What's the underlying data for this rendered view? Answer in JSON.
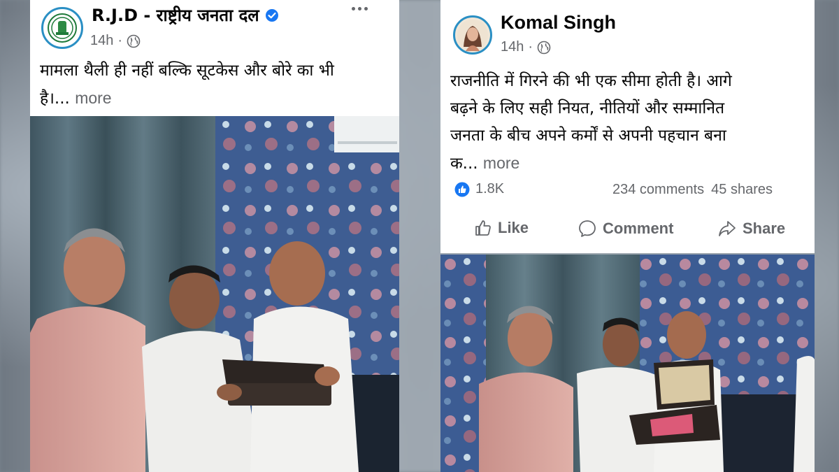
{
  "left_post": {
    "author": "R.J.D - राष्ट्रीय जनता दल",
    "time": "14h",
    "separator": "·",
    "text_line1": "मामला थैली ही नहीं बल्कि सूटकेस और बोरे का भी",
    "text_line2": "है।...",
    "more": "more",
    "verified_icon": "verified-badge-icon",
    "options_icon": "more-options-icon"
  },
  "right_post": {
    "author": "Komal Singh",
    "time": "14h",
    "separator": "·",
    "text_line1": "राजनीति में गिरने की भी एक सीमा होती है। आगे",
    "text_line2": "बढ़ने के लिए सही नियत, नीतियों और सम्मानित",
    "text_line3": "जनता के बीच अपने कर्मों से अपनी पहचान बना",
    "text_line4": "क...",
    "more": "more",
    "likes": "1.8K",
    "comments": "234 comments",
    "shares": "45 shares",
    "like_label": "Like",
    "comment_label": "Comment",
    "share_label": "Share"
  },
  "colors": {
    "facebook_blue": "#1877f2",
    "meta_grey": "#65676b",
    "text": "#050505",
    "rjd_green": "#1f7a3a"
  }
}
